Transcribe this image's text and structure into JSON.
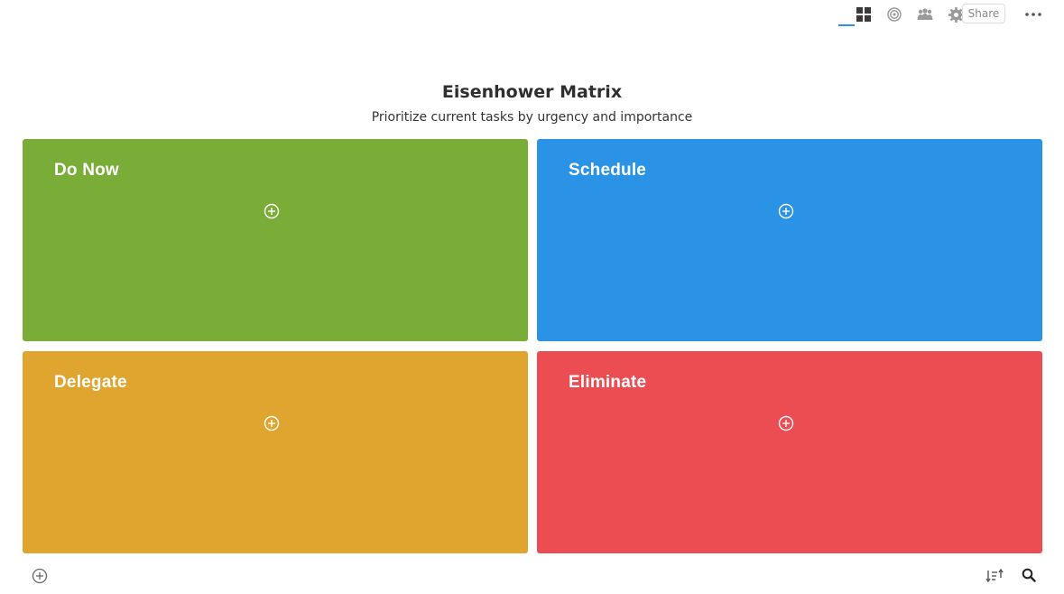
{
  "toolbar": {
    "share_label": "Share",
    "icons": [
      "grid-view-icon",
      "target-icon",
      "people-icon",
      "gear-icon",
      "more-icon"
    ],
    "accent_color": "#2b93e6"
  },
  "header": {
    "title": "Eisenhower Matrix",
    "subtitle": "Prioritize current tasks by urgency and importance"
  },
  "quadrants": [
    {
      "label": "Do Now",
      "color": "#79ad38"
    },
    {
      "label": "Schedule",
      "color": "#2b93e6"
    },
    {
      "label": "Delegate",
      "color": "#dfa52e"
    },
    {
      "label": "Eliminate",
      "color": "#ec4d52"
    }
  ],
  "footer": {
    "icons": [
      "add-icon",
      "sort-icon",
      "search-icon"
    ]
  }
}
